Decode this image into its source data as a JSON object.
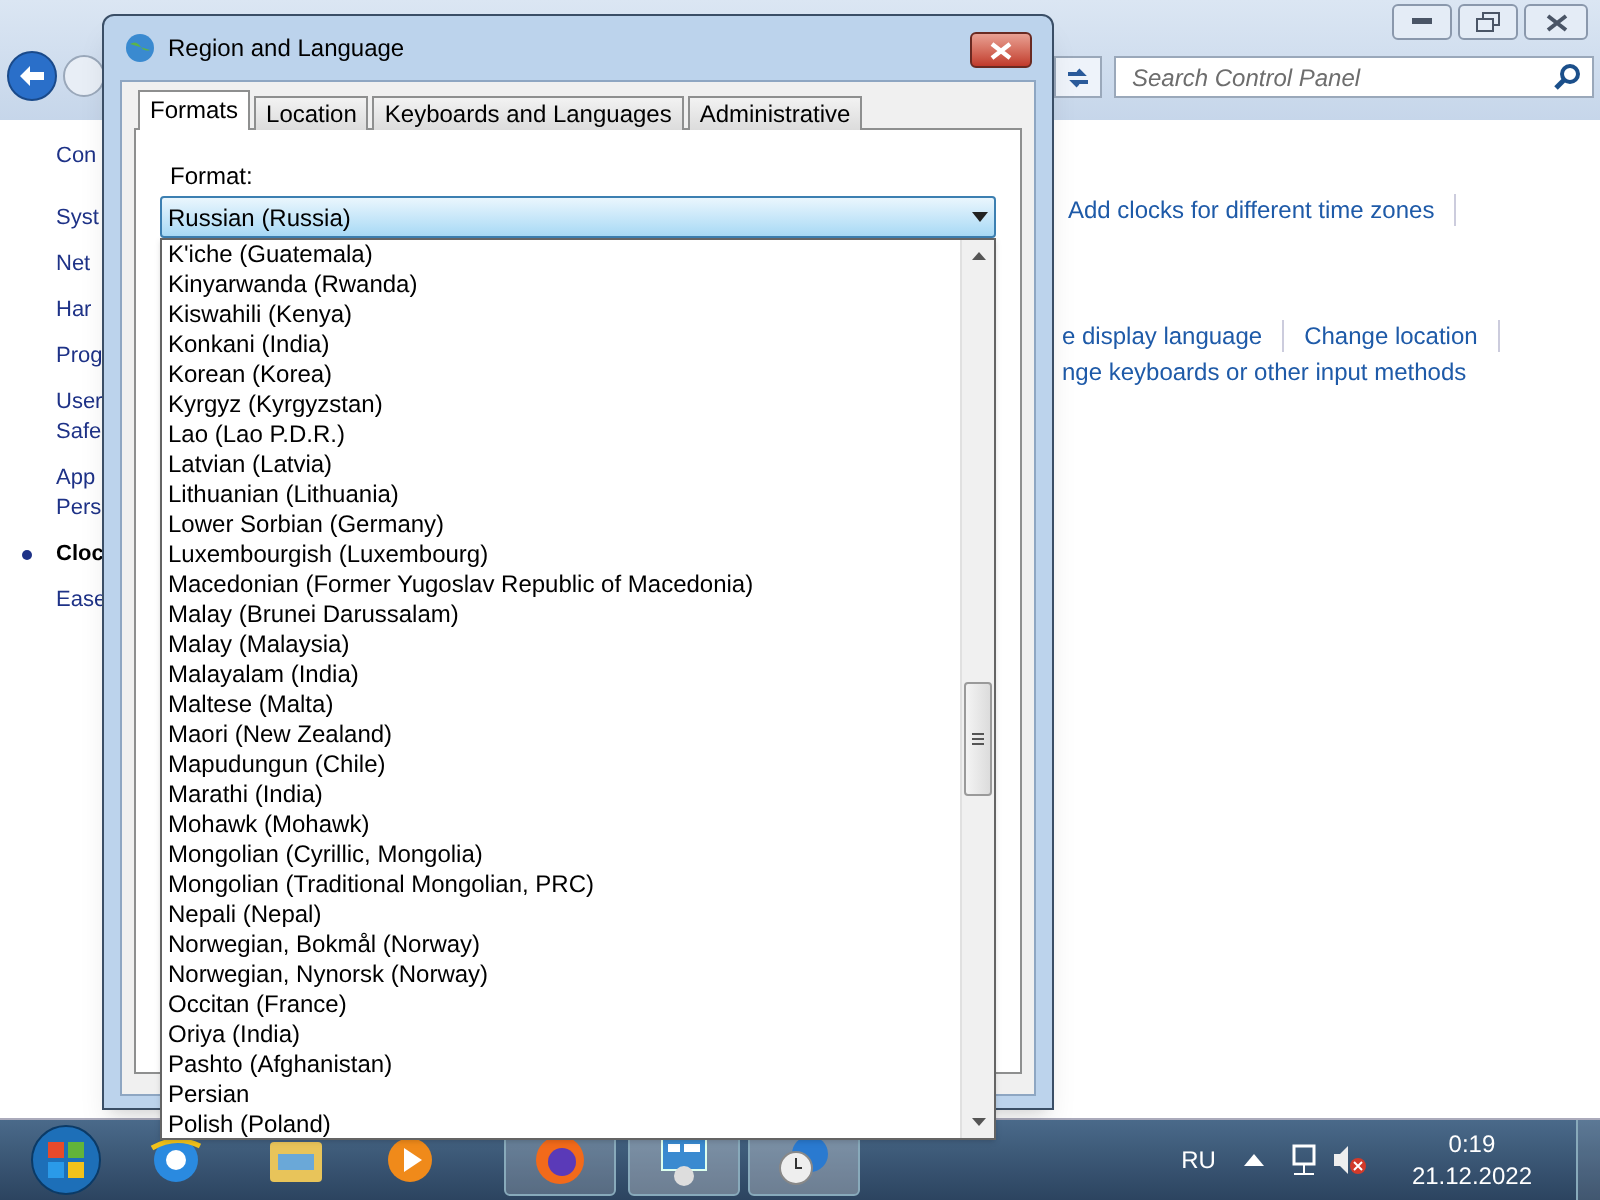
{
  "control_panel": {
    "search": {
      "placeholder": "Search Control Panel"
    },
    "sidebar": [
      {
        "label": "Con",
        "selected": false
      },
      {
        "label": "Syst",
        "selected": false
      },
      {
        "label": "Net",
        "selected": false
      },
      {
        "label": "Har",
        "selected": false
      },
      {
        "label": "Prog",
        "selected": false
      },
      {
        "label": "User\nSafe",
        "selected": false
      },
      {
        "label": "App\nPers",
        "selected": false
      },
      {
        "label": "Cloc",
        "selected": true
      },
      {
        "label": "Ease",
        "selected": false
      }
    ],
    "links": [
      [
        "Add clocks for different time zones"
      ],
      [
        "e display language",
        "Change location"
      ],
      [
        "nge keyboards or other input methods"
      ]
    ]
  },
  "dialog": {
    "title": "Region and Language",
    "tabs": [
      {
        "label": "Formats",
        "selected": true
      },
      {
        "label": "Location",
        "selected": false
      },
      {
        "label": "Keyboards and Languages",
        "selected": false
      },
      {
        "label": "Administrative",
        "selected": false
      }
    ],
    "format_label": "Format:",
    "format_value": "Russian (Russia)",
    "options": [
      "K'iche (Guatemala)",
      "Kinyarwanda (Rwanda)",
      "Kiswahili (Kenya)",
      "Konkani (India)",
      "Korean (Korea)",
      "Kyrgyz (Kyrgyzstan)",
      "Lao (Lao P.D.R.)",
      "Latvian (Latvia)",
      "Lithuanian (Lithuania)",
      "Lower Sorbian (Germany)",
      "Luxembourgish (Luxembourg)",
      "Macedonian (Former Yugoslav Republic of Macedonia)",
      "Malay (Brunei Darussalam)",
      "Malay (Malaysia)",
      "Malayalam (India)",
      "Maltese (Malta)",
      "Maori (New Zealand)",
      "Mapudungun (Chile)",
      "Marathi (India)",
      "Mohawk (Mohawk)",
      "Mongolian (Cyrillic, Mongolia)",
      "Mongolian (Traditional Mongolian, PRC)",
      "Nepali (Nepal)",
      "Norwegian, Bokmål (Norway)",
      "Norwegian, Nynorsk (Norway)",
      "Occitan (France)",
      "Oriya (India)",
      "Pashto (Afghanistan)",
      "Persian",
      "Polish (Poland)"
    ]
  },
  "taskbar": {
    "language": "RU",
    "time": "0:19",
    "date": "21.12.2022"
  }
}
